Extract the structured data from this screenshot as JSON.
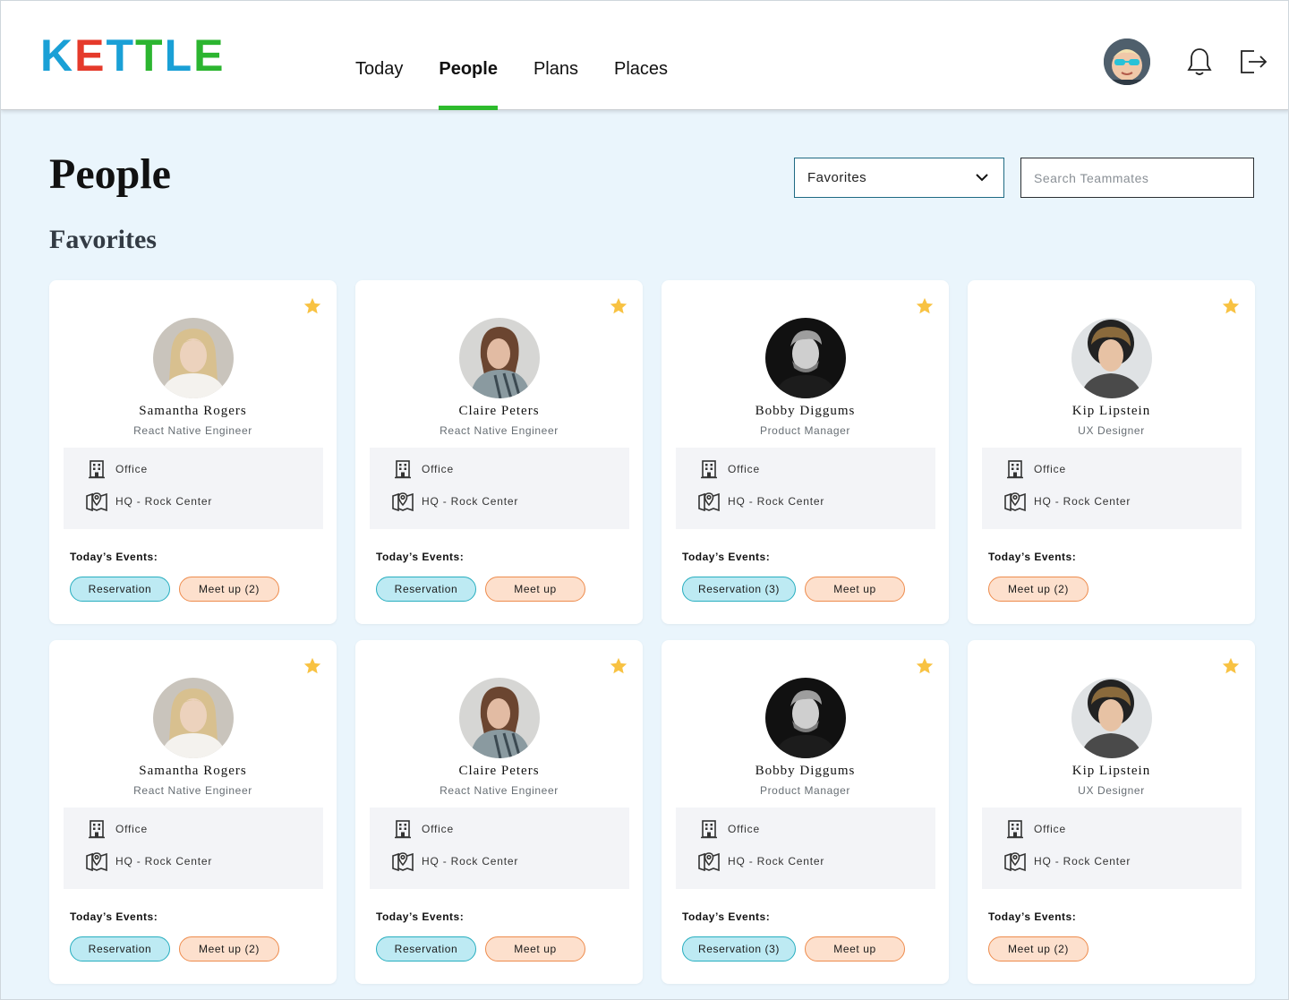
{
  "app": {
    "logo_letters": [
      "K",
      "E",
      "T",
      "T",
      "L",
      "E"
    ],
    "logo_colors": [
      "#1aa0d6",
      "#e53a2b",
      "#1aa0d6",
      "#2cb530",
      "#1aa0d6",
      "#2cb530"
    ]
  },
  "nav": {
    "items": [
      {
        "label": "Today",
        "active": false
      },
      {
        "label": "People",
        "active": true
      },
      {
        "label": "Plans",
        "active": false
      },
      {
        "label": "Places",
        "active": false
      }
    ]
  },
  "header": {
    "icons": [
      "user-avatar",
      "bell-icon",
      "logout-icon"
    ]
  },
  "page": {
    "title": "People",
    "section_title": "Favorites"
  },
  "filter": {
    "selected": "Favorites"
  },
  "search": {
    "placeholder": "Search Teammates"
  },
  "colors": {
    "accent": "#2dbb2d",
    "star": "#f8c242",
    "reservation_bg": "#bdeaf3",
    "reservation_border": "#27aebf",
    "meetup_bg": "#fde0cd",
    "meetup_border": "#ee8c4d"
  },
  "cards": [
    {
      "name": "Samantha Rogers",
      "role": "React Native Engineer",
      "location_type": "Office",
      "location_name": "HQ - Rock Center",
      "events_label": "Today’s Events:",
      "events": [
        {
          "kind": "reservation",
          "label": "Reservation"
        },
        {
          "kind": "meetup",
          "label": "Meet up (2)"
        }
      ]
    },
    {
      "name": "Claire Peters",
      "role": "React Native Engineer",
      "location_type": "Office",
      "location_name": "HQ - Rock Center",
      "events_label": "Today’s Events:",
      "events": [
        {
          "kind": "reservation",
          "label": "Reservation"
        },
        {
          "kind": "meetup",
          "label": "Meet up"
        }
      ]
    },
    {
      "name": "Bobby Diggums",
      "role": "Product Manager",
      "location_type": "Office",
      "location_name": "HQ - Rock Center",
      "events_label": "Today’s Events:",
      "events": [
        {
          "kind": "reservation",
          "label": "Reservation (3)"
        },
        {
          "kind": "meetup",
          "label": "Meet up"
        }
      ]
    },
    {
      "name": "Kip Lipstein",
      "role": "UX Designer",
      "location_type": "Office",
      "location_name": "HQ - Rock Center",
      "events_label": "Today’s Events:",
      "events": [
        {
          "kind": "meetup",
          "label": "Meet up (2)"
        }
      ]
    },
    {
      "name": "Samantha Rogers",
      "role": "React Native Engineer",
      "location_type": "Office",
      "location_name": "HQ - Rock Center",
      "events_label": "Today’s Events:",
      "events": [
        {
          "kind": "reservation",
          "label": "Reservation"
        },
        {
          "kind": "meetup",
          "label": "Meet up (2)"
        }
      ]
    },
    {
      "name": "Claire Peters",
      "role": "React Native Engineer",
      "location_type": "Office",
      "location_name": "HQ - Rock Center",
      "events_label": "Today’s Events:",
      "events": [
        {
          "kind": "reservation",
          "label": "Reservation"
        },
        {
          "kind": "meetup",
          "label": "Meet up"
        }
      ]
    },
    {
      "name": "Bobby Diggums",
      "role": "Product Manager",
      "location_type": "Office",
      "location_name": "HQ - Rock Center",
      "events_label": "Today’s Events:",
      "events": [
        {
          "kind": "reservation",
          "label": "Reservation (3)"
        },
        {
          "kind": "meetup",
          "label": "Meet up"
        }
      ]
    },
    {
      "name": "Kip Lipstein",
      "role": "UX Designer",
      "location_type": "Office",
      "location_name": "HQ - Rock Center",
      "events_label": "Today’s Events:",
      "events": [
        {
          "kind": "meetup",
          "label": "Meet up (2)"
        }
      ]
    }
  ]
}
